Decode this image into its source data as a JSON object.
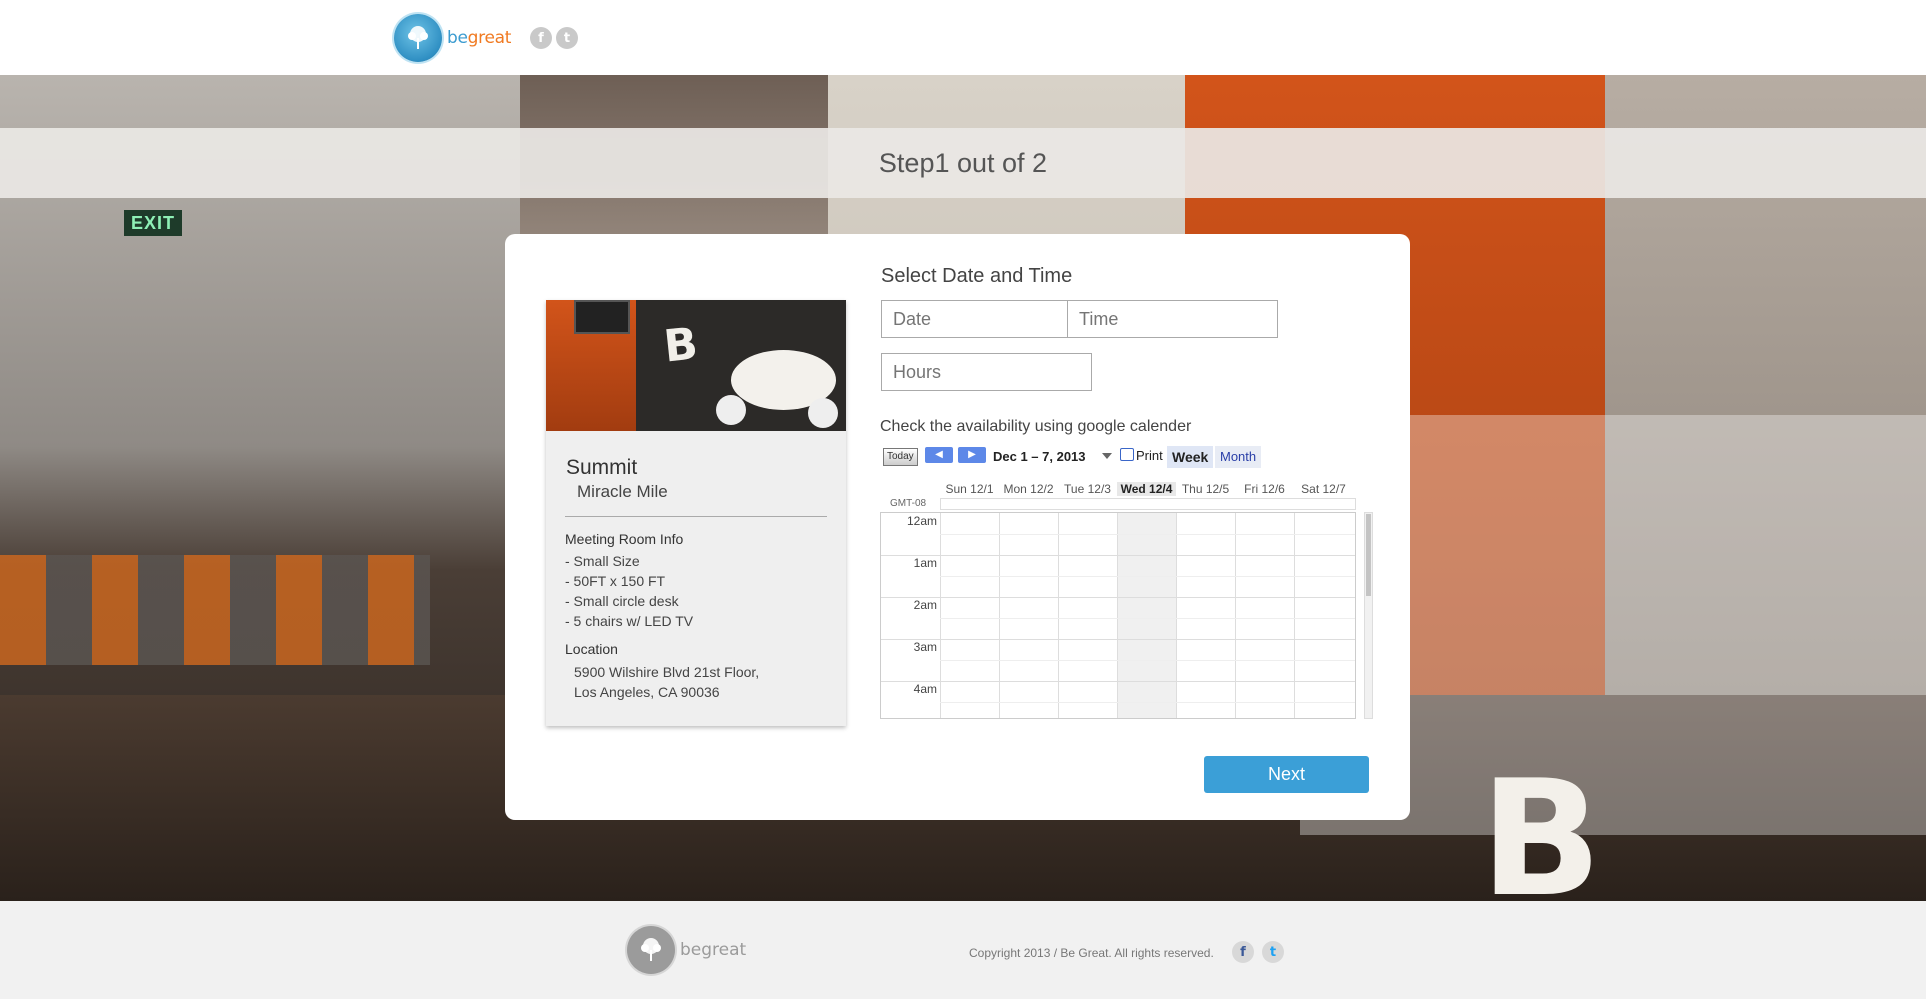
{
  "brand": {
    "be": "be",
    "great": "great",
    "footer_name": "begreat"
  },
  "header": {
    "social": [
      {
        "name": "facebook",
        "glyph": "f"
      },
      {
        "name": "twitter",
        "glyph": "t"
      }
    ]
  },
  "step": {
    "label": "Step1 out of 2"
  },
  "room": {
    "name": "Summit",
    "sub": "Miracle Mile",
    "info_heading": "Meeting Room Info",
    "info": [
      "- Small Size",
      "- 50FT x 150 FT",
      "- Small circle desk",
      "- 5 chairs w/ LED TV"
    ],
    "location_heading": "Location",
    "address_line1": "5900 Wilshire Blvd 21st Floor,",
    "address_line2": "Los Angeles, CA 90036"
  },
  "form": {
    "title": "Select Date and Time",
    "date_placeholder": "Date",
    "time_placeholder": "Time",
    "hours_placeholder": "Hours",
    "availability_text": "Check the availability using google calender",
    "next_label": "Next"
  },
  "calendar": {
    "today_label": "Today",
    "range": "Dec 1 – 7, 2013",
    "print_label": "Print",
    "week_label": "Week",
    "month_label": "Month",
    "timezone": "GMT-08",
    "days": [
      "Sun 12/1",
      "Mon 12/2",
      "Tue 12/3",
      "Wed 12/4",
      "Thu 12/5",
      "Fri 12/6",
      "Sat 12/7"
    ],
    "today_index": 3,
    "hours": [
      "12am",
      "1am",
      "2am",
      "3am",
      "4am"
    ]
  },
  "footer": {
    "copyright": "Copyright 2013 / Be Great. All rights reserved."
  },
  "colors": {
    "accent": "#3b9fd7",
    "brand_orange": "#f07a22",
    "brand_blue": "#3a9bd0"
  }
}
